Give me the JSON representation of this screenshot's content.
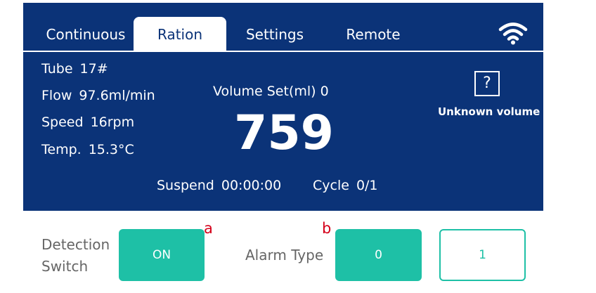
{
  "tabs": [
    {
      "label": "Continuous",
      "active": false
    },
    {
      "label": "Ration",
      "active": true
    },
    {
      "label": "Settings",
      "active": false
    },
    {
      "label": "Remote",
      "active": false
    }
  ],
  "wifi_icon": "wifi-icon",
  "info": {
    "tube_label": "Tube",
    "tube_value": "17#",
    "flow_label": "Flow",
    "flow_value": "97.6ml/min",
    "speed_label": "Speed",
    "speed_value": "16rpm",
    "temp_label": "Temp.",
    "temp_value": "15.3°C"
  },
  "volume": {
    "set_label": "Volume Set(ml)",
    "set_value": "0",
    "current": "759"
  },
  "unknown_volume": {
    "icon_glyph": "?",
    "label": "Unknown volume"
  },
  "status": {
    "suspend_label": "Suspend",
    "suspend_value": "00:00:00",
    "cycle_label": "Cycle",
    "cycle_value": "0/1"
  },
  "controls": {
    "detection_label_line1": "Detection",
    "detection_label_line2": "Switch",
    "detection_button": "ON",
    "marker_a": "a",
    "alarm_label": "Alarm Type",
    "marker_b": "b",
    "alarm_option_0": "0",
    "alarm_option_1": "1"
  },
  "colors": {
    "panel": "#0b3378",
    "accent": "#1ec0a6",
    "marker": "#d4001a"
  }
}
